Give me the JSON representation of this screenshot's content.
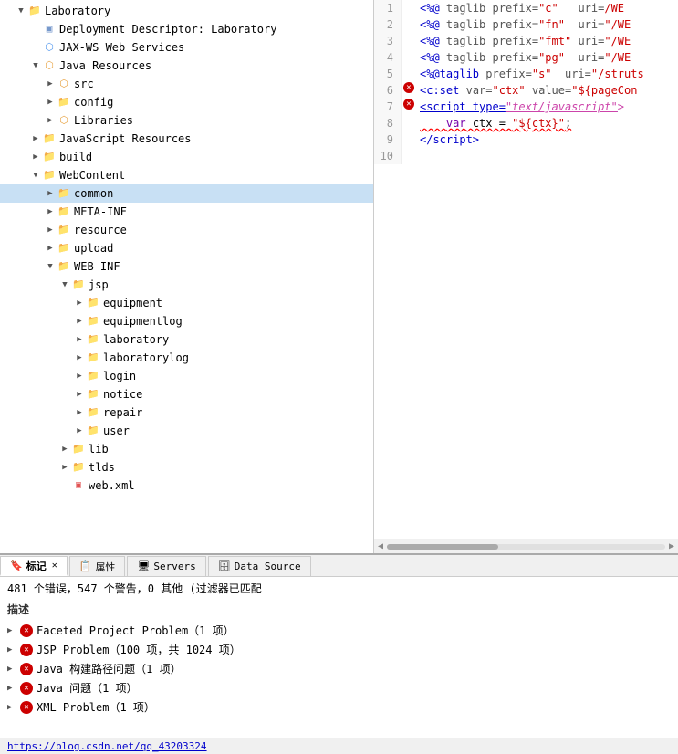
{
  "tree": {
    "items": [
      {
        "id": "laboratory",
        "label": "Laboratory",
        "level": 0,
        "indent": 1,
        "arrow": "▼",
        "icon": "📁",
        "iconClass": "icon-folder"
      },
      {
        "id": "deployment",
        "label": "Deployment Descriptor: Laboratory",
        "level": 1,
        "indent": 2,
        "arrow": "",
        "icon": "🗒",
        "iconClass": "icon-deploy"
      },
      {
        "id": "jax-ws",
        "label": "JAX-WS Web Services",
        "level": 1,
        "indent": 2,
        "arrow": "",
        "icon": "🌐",
        "iconClass": "icon-web"
      },
      {
        "id": "java-resources",
        "label": "Java Resources",
        "level": 1,
        "indent": 2,
        "arrow": "▼",
        "icon": "📦",
        "iconClass": "icon-package"
      },
      {
        "id": "src",
        "label": "src",
        "level": 2,
        "indent": 3,
        "arrow": "▶",
        "icon": "📦",
        "iconClass": "icon-package"
      },
      {
        "id": "config",
        "label": "config",
        "level": 2,
        "indent": 3,
        "arrow": "▶",
        "icon": "📁",
        "iconClass": "icon-folder"
      },
      {
        "id": "libraries",
        "label": "Libraries",
        "level": 2,
        "indent": 3,
        "arrow": "▶",
        "icon": "📚",
        "iconClass": "icon-package"
      },
      {
        "id": "js-resources",
        "label": "JavaScript Resources",
        "level": 1,
        "indent": 2,
        "arrow": "▶",
        "icon": "📁",
        "iconClass": "icon-folder"
      },
      {
        "id": "build",
        "label": "build",
        "level": 1,
        "indent": 2,
        "arrow": "▶",
        "icon": "📁",
        "iconClass": "icon-folder"
      },
      {
        "id": "webcontent",
        "label": "WebContent",
        "level": 1,
        "indent": 2,
        "arrow": "▼",
        "icon": "📁",
        "iconClass": "icon-folder"
      },
      {
        "id": "common",
        "label": "common",
        "level": 2,
        "indent": 3,
        "arrow": "▶",
        "icon": "📁",
        "iconClass": "icon-folder",
        "highlighted": true
      },
      {
        "id": "meta-inf",
        "label": "META-INF",
        "level": 2,
        "indent": 3,
        "arrow": "▶",
        "icon": "📁",
        "iconClass": "icon-folder"
      },
      {
        "id": "resource",
        "label": "resource",
        "level": 2,
        "indent": 3,
        "arrow": "▶",
        "icon": "📁",
        "iconClass": "icon-folder"
      },
      {
        "id": "upload",
        "label": "upload",
        "level": 2,
        "indent": 3,
        "arrow": "▶",
        "icon": "📁",
        "iconClass": "icon-folder"
      },
      {
        "id": "web-inf",
        "label": "WEB-INF",
        "level": 2,
        "indent": 3,
        "arrow": "▼",
        "icon": "📁",
        "iconClass": "icon-folder"
      },
      {
        "id": "jsp",
        "label": "jsp",
        "level": 3,
        "indent": 4,
        "arrow": "▼",
        "icon": "📁",
        "iconClass": "icon-folder"
      },
      {
        "id": "equipment",
        "label": "equipment",
        "level": 4,
        "indent": 5,
        "arrow": "▶",
        "icon": "📁",
        "iconClass": "icon-folder"
      },
      {
        "id": "equipmentlog",
        "label": "equipmentlog",
        "level": 4,
        "indent": 5,
        "arrow": "▶",
        "icon": "📁",
        "iconClass": "icon-folder"
      },
      {
        "id": "laboratory",
        "label": "laboratory",
        "level": 4,
        "indent": 5,
        "arrow": "▶",
        "icon": "📁",
        "iconClass": "icon-folder"
      },
      {
        "id": "laboratorylog",
        "label": "laboratorylog",
        "level": 4,
        "indent": 5,
        "arrow": "▶",
        "icon": "📁",
        "iconClass": "icon-folder"
      },
      {
        "id": "login",
        "label": "login",
        "level": 4,
        "indent": 5,
        "arrow": "▶",
        "icon": "📁",
        "iconClass": "icon-folder"
      },
      {
        "id": "notice",
        "label": "notice",
        "level": 4,
        "indent": 5,
        "arrow": "▶",
        "icon": "📁",
        "iconClass": "icon-folder"
      },
      {
        "id": "repair",
        "label": "repair",
        "level": 4,
        "indent": 5,
        "arrow": "▶",
        "icon": "📁",
        "iconClass": "icon-folder"
      },
      {
        "id": "user",
        "label": "user",
        "level": 4,
        "indent": 5,
        "arrow": "▶",
        "icon": "📁",
        "iconClass": "icon-folder"
      },
      {
        "id": "lib",
        "label": "lib",
        "level": 3,
        "indent": 4,
        "arrow": "▶",
        "icon": "📁",
        "iconClass": "icon-folder"
      },
      {
        "id": "tlds",
        "label": "tlds",
        "level": 3,
        "indent": 4,
        "arrow": "▶",
        "icon": "📁",
        "iconClass": "icon-folder"
      },
      {
        "id": "web-xml",
        "label": "web.xml",
        "level": 3,
        "indent": 4,
        "arrow": "",
        "icon": "🗎",
        "iconClass": "icon-xml"
      }
    ]
  },
  "code": {
    "lines": [
      {
        "num": 1,
        "error": false,
        "html_id": "line1"
      },
      {
        "num": 2,
        "error": false,
        "html_id": "line2"
      },
      {
        "num": 3,
        "error": false,
        "html_id": "line3"
      },
      {
        "num": 4,
        "error": false,
        "html_id": "line4"
      },
      {
        "num": 5,
        "error": false,
        "html_id": "line5"
      },
      {
        "num": 6,
        "error": true,
        "html_id": "line6"
      },
      {
        "num": 7,
        "error": true,
        "html_id": "line7"
      },
      {
        "num": 8,
        "error": false,
        "html_id": "line8"
      },
      {
        "num": 9,
        "error": false,
        "html_id": "line9"
      },
      {
        "num": 10,
        "error": false,
        "html_id": "line10"
      }
    ]
  },
  "bottom_tabs": [
    {
      "id": "markers",
      "label": "标记",
      "icon": "🔖",
      "active": true
    },
    {
      "id": "properties",
      "label": "属性",
      "icon": "📋",
      "active": false
    },
    {
      "id": "servers",
      "label": "Servers",
      "icon": "🖥",
      "active": false
    },
    {
      "id": "datasource",
      "label": "Data Source",
      "icon": "🗄",
      "active": false
    }
  ],
  "error_summary": "481 个错误，547 个警告，0 其他 (过滤器已匹配",
  "column_header": "描述",
  "error_rows": [
    {
      "id": "faceted",
      "label": "Faceted Project Problem（1 项）"
    },
    {
      "id": "jsp",
      "label": "JSP Problem（100 项，共 1024 项）"
    },
    {
      "id": "java-build",
      "label": "Java 构建路径问题（1 项）"
    },
    {
      "id": "java-problem",
      "label": "Java 问题（1 项）"
    },
    {
      "id": "xml-problem",
      "label": "XML Problem（1 项）"
    }
  ],
  "status_bar": {
    "url": "https://blog.csdn.net/qq_43203324"
  }
}
